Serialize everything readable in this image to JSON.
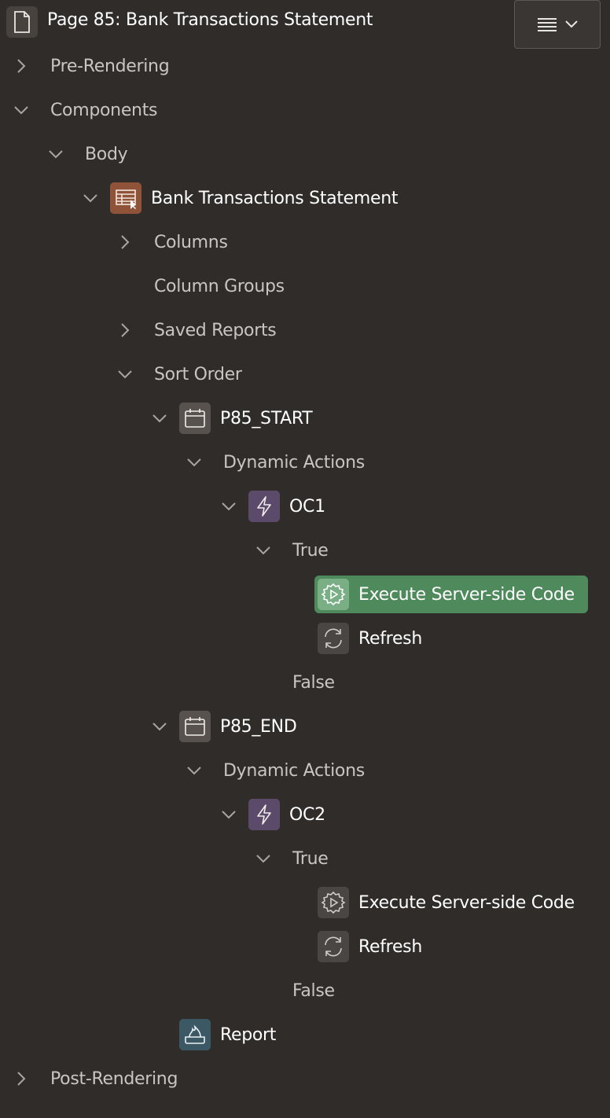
{
  "header": {
    "title": "Page 85: Bank Transactions Statement",
    "menu_icon": "hamburger-icon"
  },
  "tree": {
    "pre_rendering": "Pre-Rendering",
    "components": "Components",
    "body": "Body",
    "region": "Bank Transactions Statement",
    "columns": "Columns",
    "column_groups": "Column Groups",
    "saved_reports": "Saved Reports",
    "sort_order": "Sort Order",
    "item1": {
      "name": "P85_START",
      "dynamic_actions": "Dynamic Actions",
      "da_name": "OC1",
      "true_label": "True",
      "action1": "Execute Server-side Code",
      "action2": "Refresh",
      "false_label": "False"
    },
    "item2": {
      "name": "P85_END",
      "dynamic_actions": "Dynamic Actions",
      "da_name": "OC2",
      "true_label": "True",
      "action1": "Execute Server-side Code",
      "action2": "Refresh",
      "false_label": "False"
    },
    "report": "Report",
    "post_rendering": "Post-Rendering"
  },
  "colors": {
    "background": "#2f2c2a",
    "selected": "#4e8a5c",
    "dynamic_action": "#5b4a6a",
    "region_icon": "#8e5339"
  }
}
